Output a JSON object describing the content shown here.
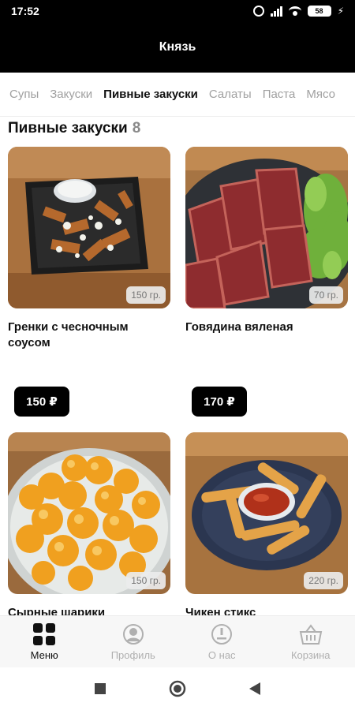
{
  "status_bar": {
    "time": "17:52",
    "battery": "58"
  },
  "header": {
    "title": "Князь"
  },
  "tabs": [
    {
      "label": "Супы"
    },
    {
      "label": "Закуски"
    },
    {
      "label": "Пивные закуски",
      "active": true
    },
    {
      "label": "Салаты"
    },
    {
      "label": "Паста"
    },
    {
      "label": "Мясо"
    }
  ],
  "section": {
    "title": "Пивные закуски",
    "count": "8"
  },
  "products": [
    {
      "name": "Гренки с чесночным соусом",
      "weight": "150 гр.",
      "price": "150 ₽"
    },
    {
      "name": "Говядина вяленая",
      "weight": "70 гр.",
      "price": "170 ₽"
    },
    {
      "name": "Сырные шарики",
      "weight": "150 гр."
    },
    {
      "name": "Чикен стикс",
      "weight": "220 гр."
    }
  ],
  "bottom_nav": [
    {
      "label": "Меню",
      "icon": "grid-icon",
      "active": true
    },
    {
      "label": "Профиль",
      "icon": "profile-icon"
    },
    {
      "label": "О нас",
      "icon": "info-icon"
    },
    {
      "label": "Корзина",
      "icon": "basket-icon"
    }
  ],
  "colors": {
    "header_bg": "#000000",
    "active_text": "#111111",
    "inactive_text": "#a0a0a0",
    "price_bg": "#000000"
  }
}
